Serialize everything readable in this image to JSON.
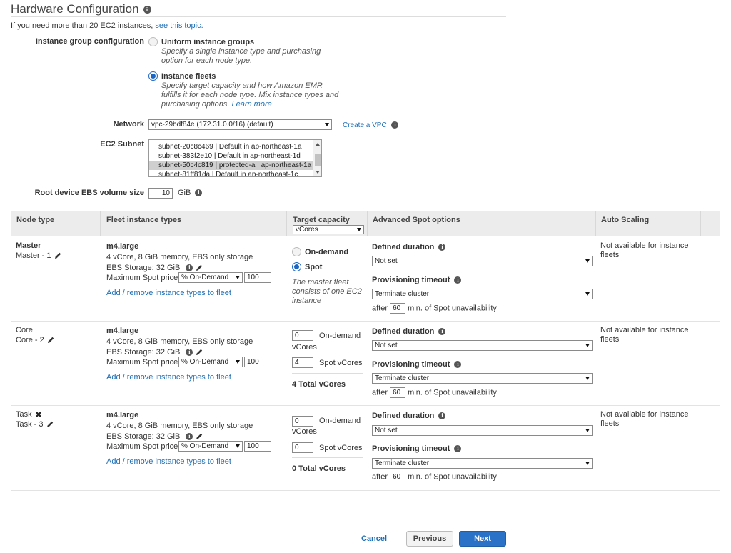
{
  "header": {
    "title": "Hardware Configuration",
    "intro_text": "If you need more than 20 EC2 instances, ",
    "intro_link": "see this topic."
  },
  "instance_group_config": {
    "label": "Instance group configuration",
    "options": [
      {
        "title": "Uniform instance groups",
        "desc": "Specify a single instance type and purchasing option for each node type.",
        "selected": false
      },
      {
        "title": "Instance fleets",
        "desc": "Specify target capacity and how Amazon EMR fulfills it for each node type. Mix instance types and purchasing options.",
        "link": "Learn more",
        "selected": true
      }
    ]
  },
  "network": {
    "label": "Network",
    "value": "vpc-29bdf84e (172.31.0.0/16) (default)",
    "create_link": "Create a VPC"
  },
  "subnet": {
    "label": "EC2 Subnet",
    "options": [
      "subnet-20c8c469 | Default in ap-northeast-1a",
      "subnet-383f2e10 | Default in ap-northeast-1d",
      "subnet-50c4c819 | protected-a | ap-northeast-1a",
      "subnet-81ff81da | Default in ap-northeast-1c"
    ],
    "selected_index": 2
  },
  "root_volume": {
    "label": "Root device EBS volume size",
    "value": "10",
    "unit": "GiB"
  },
  "table": {
    "headers": {
      "node_type": "Node type",
      "fleet_types": "Fleet instance types",
      "target_capacity": "Target capacity",
      "target_capacity_select": "vCores",
      "spot_options": "Advanced Spot options",
      "auto_scaling": "Auto Scaling"
    },
    "rows": [
      {
        "node": "Master",
        "sub": "Master - 1",
        "instance": "m4.large",
        "spec": "4 vCore, 8 GiB memory, EBS only storage",
        "ebs": "EBS Storage:  32 GiB",
        "max_spot_label": "Maximum Spot price:",
        "max_spot_select": "% On-Demand",
        "max_spot_value": "100",
        "add_link": "Add / remove instance types to fleet",
        "cap_on_demand": "On-demand",
        "cap_spot": "Spot",
        "cap_note": "The master fleet consists of one EC2 instance",
        "defined_duration_label": "Defined duration",
        "defined_duration_value": "Not set",
        "prov_timeout_label": "Provisioning timeout",
        "prov_timeout_value": "Terminate cluster",
        "after_label": "after",
        "after_value": "60",
        "after_suffix": "min. of Spot unavailability",
        "auto_scaling": "Not available for instance fleets"
      },
      {
        "node": "Core",
        "sub": "Core - 2",
        "instance": "m4.large",
        "spec": "4 vCore, 8 GiB memory, EBS only storage",
        "ebs": "EBS Storage:  32 GiB",
        "max_spot_label": "Maximum Spot price:",
        "max_spot_select": "% On-Demand",
        "max_spot_value": "100",
        "add_link": "Add / remove instance types to fleet",
        "on_demand_value": "0",
        "on_demand_label": "On-demand",
        "on_demand_unit": "vCores",
        "spot_value": "4",
        "spot_label": "Spot vCores",
        "total": "4 Total vCores",
        "defined_duration_label": "Defined duration",
        "defined_duration_value": "Not set",
        "prov_timeout_label": "Provisioning timeout",
        "prov_timeout_value": "Terminate cluster",
        "after_label": "after",
        "after_value": "60",
        "after_suffix": "min. of Spot unavailability",
        "auto_scaling": "Not available for instance fleets"
      },
      {
        "node": "Task",
        "sub": "Task - 3",
        "instance": "m4.large",
        "spec": "4 vCore, 8 GiB memory, EBS only storage",
        "ebs": "EBS Storage:  32 GiB",
        "max_spot_label": "Maximum Spot price:",
        "max_spot_select": "% On-Demand",
        "max_spot_value": "100",
        "add_link": "Add / remove instance types to fleet",
        "on_demand_value": "0",
        "on_demand_label": "On-demand",
        "on_demand_unit": "vCores",
        "spot_value": "0",
        "spot_label": "Spot vCores",
        "total": "0 Total vCores",
        "defined_duration_label": "Defined duration",
        "defined_duration_value": "Not set",
        "prov_timeout_label": "Provisioning timeout",
        "prov_timeout_value": "Terminate cluster",
        "after_label": "after",
        "after_value": "60",
        "after_suffix": "min. of Spot unavailability",
        "auto_scaling": "Not available for instance fleets"
      }
    ]
  },
  "footer": {
    "cancel": "Cancel",
    "previous": "Previous",
    "next": "Next"
  },
  "colors": {
    "link": "#1f6fb5",
    "primary_button": "#2a72c8",
    "radio_selected": "#1a66c2"
  }
}
